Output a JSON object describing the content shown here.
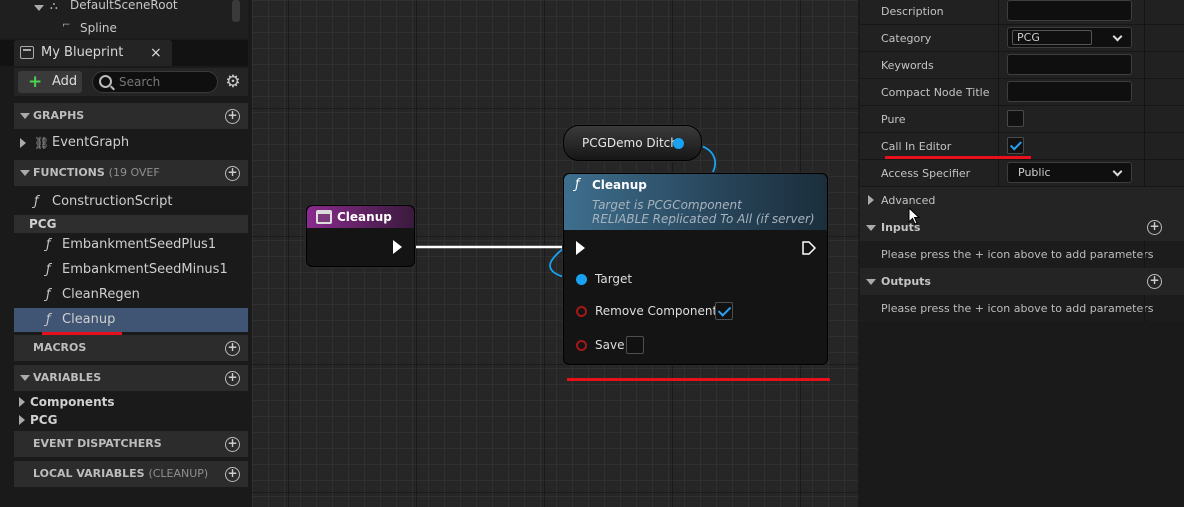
{
  "components": {
    "root": "DefaultSceneRoot",
    "child": "Spline"
  },
  "tab": {
    "label": "My Blueprint",
    "close": "×"
  },
  "toolbar": {
    "add_label": "Add",
    "search_placeholder": "Search"
  },
  "sections": {
    "graphs": "GRAPHS",
    "functions": "FUNCTIONS",
    "functions_sub": "(19 OVEF",
    "macros": "MACROS",
    "variables": "VARIABLES",
    "event_dispatchers": "EVENT DISPATCHERS",
    "local_variables": "LOCAL VARIABLES",
    "local_variables_sub": "(CLEANUP)"
  },
  "graphs": [
    "EventGraph"
  ],
  "functions": {
    "construction": "ConstructionScript",
    "category": "PCG",
    "items": [
      "EmbankmentSeedPlus1",
      "EmbankmentSeedMinus1",
      "CleanRegen",
      "Cleanup"
    ]
  },
  "variables": [
    "Components",
    "PCG"
  ],
  "graph": {
    "event_node_title": "Cleanup",
    "var_node_title": "PCGDemo Ditch",
    "fn_node": {
      "title": "Cleanup",
      "sub1": "Target is PCGComponent",
      "sub2": "RELIABLE Replicated To All (if server)",
      "pins": [
        "Target",
        "Remove Components",
        "Save"
      ]
    }
  },
  "details": {
    "rows": [
      {
        "label": "Description",
        "type": "text",
        "value": ""
      },
      {
        "label": "Category",
        "type": "combo",
        "value": "PCG"
      },
      {
        "label": "Keywords",
        "type": "text",
        "value": ""
      },
      {
        "label": "Compact Node Title",
        "type": "text",
        "value": ""
      },
      {
        "label": "Pure",
        "type": "check",
        "value": false
      },
      {
        "label": "Call In Editor",
        "type": "check",
        "value": true
      },
      {
        "label": "Access Specifier",
        "type": "combo",
        "value": "Public"
      }
    ],
    "advanced": "Advanced",
    "inputs": "Inputs",
    "inputs_hint": "Please press the + icon above to add parameters",
    "outputs": "Outputs",
    "outputs_hint": "Please press the + icon above to add parameters"
  },
  "colors": {
    "highlight": "#e8101a",
    "selection": "#3f5573",
    "pin_blue": "#18a2f2"
  }
}
